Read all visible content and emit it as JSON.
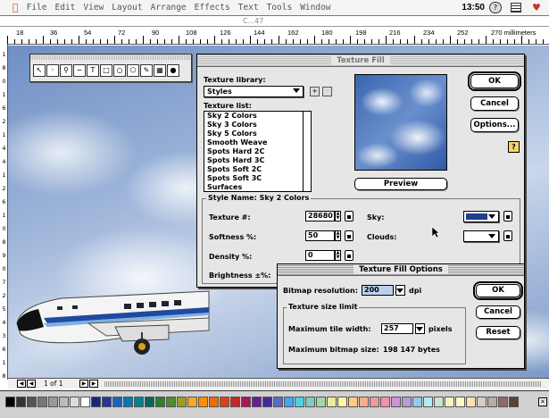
{
  "menubar": {
    "items": [
      "File",
      "Edit",
      "View",
      "Layout",
      "Arrange",
      "Effects",
      "Text",
      "Tools",
      "Window"
    ],
    "clock": "13:50",
    "help_icon": "?"
  },
  "document": {
    "title": "C...47"
  },
  "ruler": {
    "labels": [
      "18",
      "36",
      "54",
      "72",
      "90",
      "108",
      "126",
      "144",
      "162",
      "180",
      "198",
      "216",
      "234",
      "252",
      "270 millimeters"
    ],
    "vlabels": [
      "1",
      "8",
      "0",
      "1",
      "6",
      "2",
      "1",
      "4",
      "4",
      "1",
      "2",
      "6",
      "1",
      "0",
      "8",
      "9",
      "0",
      "7",
      "2",
      "5",
      "4",
      "3",
      "6",
      "1",
      "8"
    ]
  },
  "statusbar": {
    "page_label": "1 of 1"
  },
  "texture_fill": {
    "title": "Texture Fill",
    "library_label": "Texture library:",
    "library_value": "Styles",
    "list_label": "Texture list:",
    "list_items": [
      "Sky 2 Colors",
      "Sky 3 Colors",
      "Sky 5 Colors",
      "Smooth Weave",
      "Spots Hard 2C",
      "Spots Hard 3C",
      "Spots Soft 2C",
      "Spots Soft 3C",
      "Surfaces"
    ],
    "ok": "OK",
    "cancel": "Cancel",
    "options": "Options...",
    "help": "?",
    "preview": "Preview",
    "plus": "+",
    "minus": "-",
    "style_name": "Style Name: Sky 2 Colors",
    "fields": {
      "texture_label": "Texture #:",
      "texture_value": "28680",
      "softness_label": "Softness %:",
      "softness_value": "50",
      "density_label": "Density %:",
      "density_value": "0",
      "brightness_label": "Brightness ±%:",
      "sky_label": "Sky:",
      "clouds_label": "Clouds:"
    },
    "colors": {
      "sky": "#1f3f8f",
      "clouds": "#ffffff"
    }
  },
  "texture_options": {
    "title": "Texture Fill Options",
    "bitmap_label": "Bitmap resolution:",
    "bitmap_value": "200",
    "bitmap_unit": "dpi",
    "group_label": "Texture size limit",
    "tile_label": "Maximum tile width:",
    "tile_value": "257",
    "tile_unit": "pixels",
    "max_size_label": "Maximum bitmap size:",
    "max_size_value": "198 147 bytes",
    "ok": "OK",
    "cancel": "Cancel",
    "reset": "Reset"
  },
  "palette_colors": [
    "#000000",
    "#333333",
    "#555555",
    "#777777",
    "#999999",
    "#bbbbbb",
    "#dddddd",
    "#ffffff",
    "#1a237e",
    "#283593",
    "#1565c0",
    "#0277bd",
    "#00838f",
    "#00695c",
    "#2e7d32",
    "#558b2f",
    "#9e9d24",
    "#f9a825",
    "#ff8f00",
    "#ef6c00",
    "#d84315",
    "#c62828",
    "#ad1457",
    "#6a1b9a",
    "#4527a0",
    "#5c6bc0",
    "#42a5f5",
    "#4dd0e1",
    "#80cbc4",
    "#a5d6a7",
    "#e6ee9c",
    "#fff59d",
    "#ffcc80",
    "#ffab91",
    "#ef9a9a",
    "#f48fb1",
    "#ce93d8",
    "#b39ddb",
    "#90caf9",
    "#b2ebf2",
    "#c8e6c9",
    "#f0f4c3",
    "#fff9c4",
    "#ffe0b2",
    "#d7ccc8",
    "#bcaaa4",
    "#8d6e63",
    "#5d4037"
  ]
}
